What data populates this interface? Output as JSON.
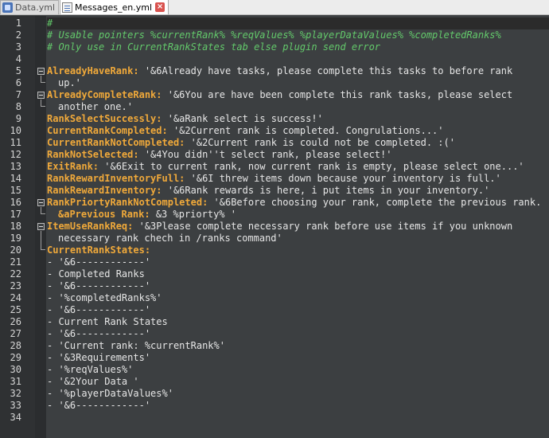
{
  "tabs": [
    {
      "label": "Data.yml",
      "active": false
    },
    {
      "label": "Messages_en.yml",
      "active": true
    }
  ],
  "line_numbers": [
    "1",
    "2",
    "3",
    "4",
    "5",
    "6",
    "7",
    "8",
    "9",
    "10",
    "11",
    "12",
    "13",
    "14",
    "15",
    "16",
    "17",
    "18",
    "19",
    "20",
    "21",
    "22",
    "23",
    "24",
    "25",
    "26",
    "27",
    "28",
    "29",
    "30",
    "31",
    "32",
    "33",
    "34"
  ],
  "code": {
    "l1": "#",
    "l2": "# Usable pointers %currentRank% %reqValues% %playerDataValues% %completedRanks%",
    "l3": "# Only use in CurrentRankStates tab else plugin send error",
    "l5_key": "AlreadyHaveRank:",
    "l5_val": " '&6Already have tasks, please complete this tasks to before rank",
    "l6": "up.'",
    "l7_key": "AlreadyCompleteRank:",
    "l7_val": " '&6You are have been complete this rank tasks, please select",
    "l8": "another one.'",
    "l9_key": "RankSelectSuccessly:",
    "l9_val": " '&aRank select is success!'",
    "l10_key": "CurrentRankCompleted:",
    "l10_val": " '&2Current rank is completed. Congrulations...'",
    "l11_key": "CurrentRankNotCompleted:",
    "l11_val": " '&2Current rank is could not be completed. :('",
    "l12_key": "RankNotSelected:",
    "l12_val": " '&4You didn''t select rank, please select!'",
    "l13_key": "ExitRank:",
    "l13_val": " '&6Exit to current rank, now current rank is empty, please select one...'",
    "l14_key": "RankRewardInventoryFull:",
    "l14_val": " '&6I threw items down because your inventory is full.'",
    "l15_key": "RankRewardInventory:",
    "l15_val": " '&6Rank rewards is here, i put items in your inventory.'",
    "l16_key": "RankPriortyRankNotCompleted:",
    "l16_val": " '&6Before choosing your rank, complete the previous rank.",
    "l17_key": "&aPrevious Rank:",
    "l17_val": " &3 %priorty% '",
    "l18_key": "ItemUseRankReq:",
    "l18_val": " '&3Please complete necessary rank before use items if you unknown",
    "l19": "necessary rank chech in /ranks command'",
    "l20_key": "CurrentRankStates:",
    "l21": "- '&6------------'",
    "l22": "- Completed Ranks",
    "l23": "- '&6------------'",
    "l24": "- '%completedRanks%'",
    "l25": "- '&6------------'",
    "l26": "- Current Rank States",
    "l27": "- '&6------------'",
    "l28": "- 'Current rank: %currentRank%'",
    "l29": "- '&3Requirements'",
    "l30": "- '%reqValues%'",
    "l31": "- '&2Your Data '",
    "l32": "- '%playerDataValues%'",
    "l33": "- '&6------------'"
  },
  "colors": {
    "comment": "#63c96b",
    "key": "#f0a93a",
    "text": "#e6e6e6",
    "background": "#3c3f41"
  }
}
